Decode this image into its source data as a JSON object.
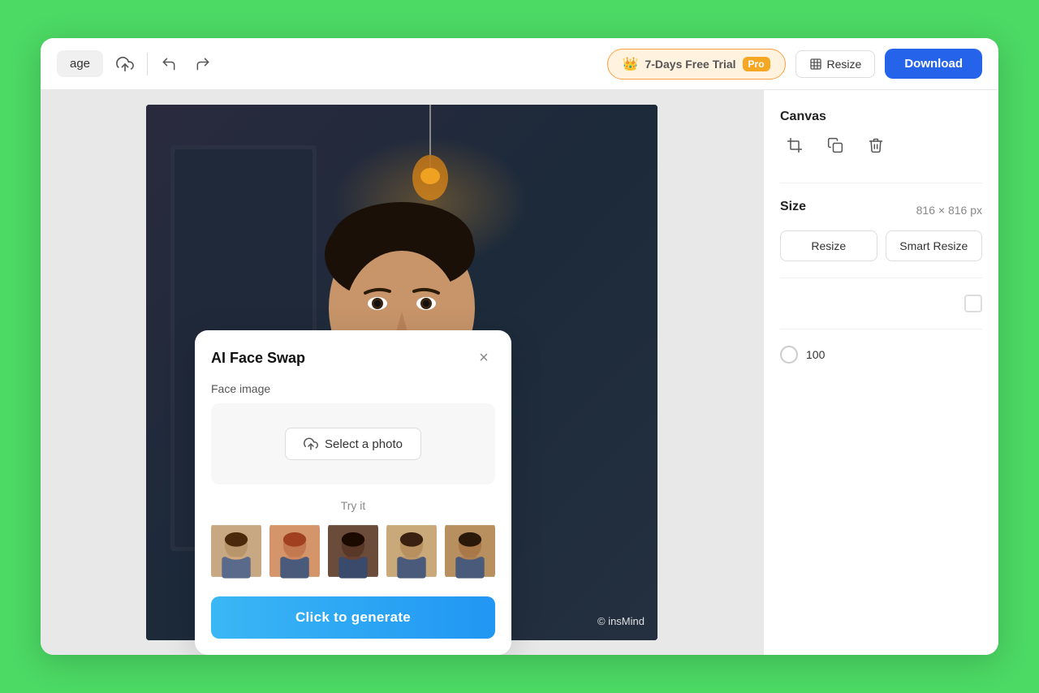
{
  "toolbar": {
    "page_label": "age",
    "undo_title": "Undo",
    "redo_title": "Redo",
    "save_icon": "cloud-icon",
    "trial": {
      "label": "7-Days Free Trial",
      "pro": "Pro"
    },
    "resize_label": "Resize",
    "download_label": "Download"
  },
  "canvas": {
    "title": "Canvas",
    "size_label": "Size",
    "size_value": "816 × 816 px",
    "resize_btn": "Resize",
    "smart_resize_btn": "Smart Resize"
  },
  "opacity": {
    "value": "100"
  },
  "face_swap": {
    "title": "AI Face Swap",
    "face_image_label": "Face image",
    "select_photo_label": "Select a photo",
    "try_it_label": "Try it",
    "generate_label": "Click to generate",
    "close_title": "Close"
  },
  "watermark": {
    "text": "© insMind"
  }
}
